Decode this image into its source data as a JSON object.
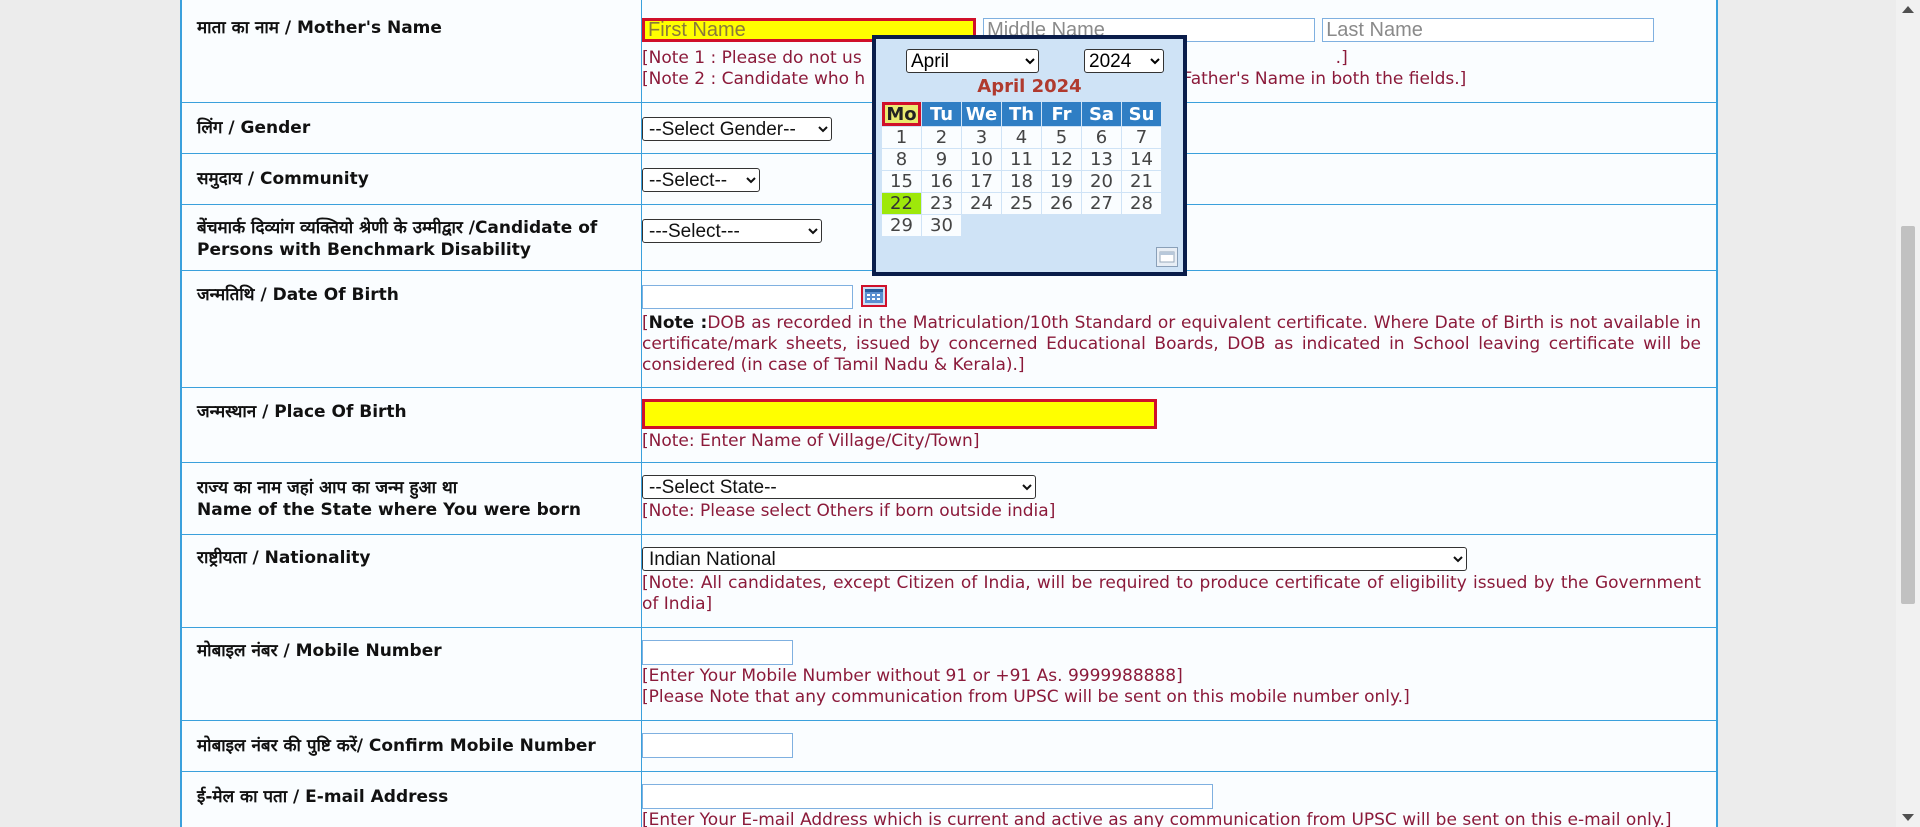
{
  "rows": {
    "mother": {
      "label": "माता का नाम / Mother's Name",
      "first_placeholder": "First Name",
      "middle_placeholder": "Middle Name",
      "last_placeholder": "Last Name",
      "note1": "[Note 1 : Please do not us",
      "note1_end": ".]",
      "note2": "[Note 2 : Candidate who h",
      "note2_end": "r's Name or Father's Name in both the fields.]"
    },
    "gender": {
      "label": "लिंग / Gender",
      "selected": "--Select Gender--"
    },
    "community": {
      "label": "समुदाय / Community",
      "selected": "--Select--"
    },
    "pwbd": {
      "label": "बेंचमार्क दिव्यांग व्यक्तियो श्रेणी के उम्मीद्वार /Candidate of Persons with Benchmark Disability",
      "selected": "---Select---"
    },
    "dob": {
      "label": "जन्मतिथि / Date Of Birth",
      "value": "",
      "note_open": "[",
      "note_bold": "Note :",
      "note_text": "DOB as recorded in the Matriculation/10th Standard or equivalent certificate. Where Date of Birth is not available in certificate/mark sheets, issued by concerned Educational Boards, DOB as indicated in School leaving certificate will be considered (in case of Tamil Nadu & Kerala).]"
    },
    "pob": {
      "label": "जन्मस्थान / Place Of Birth",
      "value": "",
      "note": "[Note: Enter Name of Village/City/Town]"
    },
    "state": {
      "label_hi": "राज्य का नाम जहां आप का जन्म हुआ था",
      "label_en": "Name of the State where You were born",
      "selected": "--Select State--",
      "note": "[Note: Please select Others if born outside india]"
    },
    "nationality": {
      "label": "राष्ट्रीयता / Nationality",
      "selected": "Indian National",
      "note": "[Note: All candidates, except Citizen of India, will be required to produce certificate of eligibility issued by the Government of India]"
    },
    "mobile": {
      "label": "मोबाइल नंबर / Mobile Number",
      "value": "",
      "note1": "[Enter Your Mobile Number without 91 or +91 As. 9999988888]",
      "note2": "[Please Note that any communication from UPSC will be sent on this mobile number only.]"
    },
    "confirm_mobile": {
      "label": "मोबाइल नंबर की पुष्टि करें/ Confirm Mobile Number",
      "value": ""
    },
    "email": {
      "label": "ई-मेल का पता / E-mail Address",
      "value": "",
      "note": "[Enter Your E-mail Address which is current and active as any communication from UPSC will be sent on this e-mail only.]"
    }
  },
  "calendar": {
    "month_selected": "April",
    "year_selected": "2024",
    "title": "April 2024",
    "weekdays": [
      "Mo",
      "Tu",
      "We",
      "Th",
      "Fr",
      "Sa",
      "Su"
    ],
    "weeks": [
      [
        "1",
        "2",
        "3",
        "4",
        "5",
        "6",
        "7"
      ],
      [
        "8",
        "9",
        "10",
        "11",
        "12",
        "13",
        "14"
      ],
      [
        "15",
        "16",
        "17",
        "18",
        "19",
        "20",
        "21"
      ],
      [
        "22",
        "23",
        "24",
        "25",
        "26",
        "27",
        "28"
      ],
      [
        "29",
        "30",
        "",
        "",
        "",
        "",
        ""
      ]
    ],
    "highlighted_day": "22",
    "highlighted_weekday": "Mo"
  },
  "colors": {
    "border": "#3aa0dc",
    "error_border": "#d0102a",
    "error_fill": "#ffff00",
    "note_text": "#8b1a3a",
    "calendar_header": "#2f7ec4",
    "calendar_title": "#b03a2e",
    "today_fill": "#9ee80a"
  },
  "icons": {
    "date_picker": "calendar-icon",
    "calendar_close": "close-icon"
  }
}
